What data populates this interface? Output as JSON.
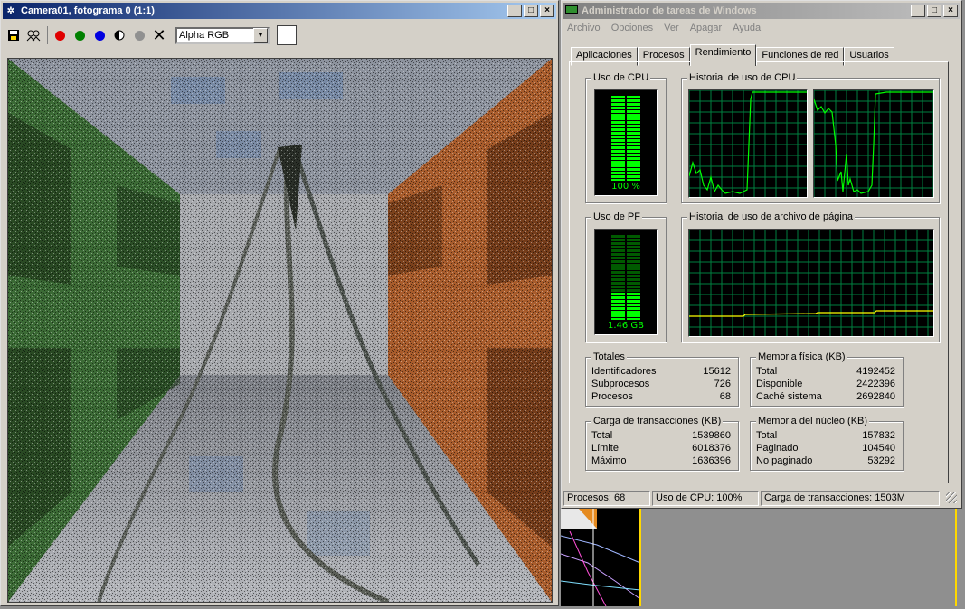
{
  "render_window": {
    "title": "Camera01, fotograma 0 (1:1)",
    "channel_select": "Alpha RGB",
    "controls": [
      "_",
      "□",
      "×"
    ]
  },
  "taskmgr": {
    "title": "Administrador de tareas de Windows",
    "controls": [
      "_",
      "□",
      "×"
    ],
    "menu": [
      "Archivo",
      "Opciones",
      "Ver",
      "Apagar",
      "Ayuda"
    ],
    "tabs": [
      "Aplicaciones",
      "Procesos",
      "Rendimiento",
      "Funciones de red",
      "Usuarios"
    ],
    "selected_tab": 2,
    "cpu_usage": {
      "label": "Uso de CPU",
      "value_text": "100 %",
      "level": 1.0
    },
    "cpu_history": {
      "label": "Historial de uso de CPU"
    },
    "pf_usage": {
      "label": "Uso de PF",
      "value_text": "1.46 GB",
      "level": 0.35
    },
    "pf_history": {
      "label": "Historial de uso de archivo de página"
    },
    "totales": {
      "label": "Totales",
      "rows": [
        {
          "k": "Identificadores",
          "v": "15612"
        },
        {
          "k": "Subprocesos",
          "v": "726"
        },
        {
          "k": "Procesos",
          "v": "68"
        }
      ]
    },
    "memoria_fisica": {
      "label": "Memoria física (KB)",
      "rows": [
        {
          "k": "Total",
          "v": "4192452"
        },
        {
          "k": "Disponible",
          "v": "2422396"
        },
        {
          "k": "Caché sistema",
          "v": "2692840"
        }
      ]
    },
    "carga": {
      "label": "Carga de transacciones (KB)",
      "rows": [
        {
          "k": "Total",
          "v": "1539860"
        },
        {
          "k": "Límite",
          "v": "6018376"
        },
        {
          "k": "Máximo",
          "v": "1636396"
        }
      ]
    },
    "memoria_nucleo": {
      "label": "Memoria del núcleo (KB)",
      "rows": [
        {
          "k": "Total",
          "v": "157832"
        },
        {
          "k": "Paginado",
          "v": "104540"
        },
        {
          "k": "No paginado",
          "v": "53292"
        }
      ]
    },
    "status": [
      "Procesos: 68",
      "Uso de CPU: 100%",
      "Carga de transacciones: 1503M"
    ]
  }
}
